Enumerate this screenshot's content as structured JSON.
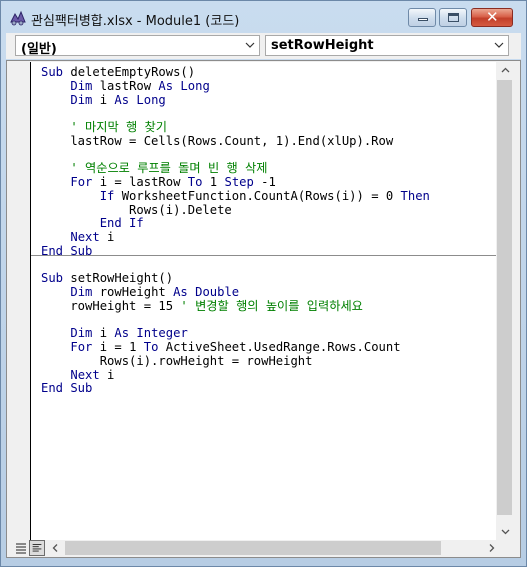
{
  "window": {
    "title": "관심팩터병합.xlsx - Module1 (코드)",
    "minimize_icon": "minimize-icon",
    "maximize_icon": "maximize-icon",
    "close_icon": "close-icon",
    "close_glyph": "✕"
  },
  "toolbar": {
    "object_combo_value": "(일반)",
    "procedure_combo_value": "setRowHeight",
    "dropdown_icon": "chevron-down-icon"
  },
  "code": {
    "lines": [
      [
        {
          "t": "Sub ",
          "c": "kw"
        },
        {
          "t": "deleteEmptyRows()",
          "c": "tx"
        }
      ],
      [
        {
          "t": "    ",
          "c": "tx"
        },
        {
          "t": "Dim ",
          "c": "kw"
        },
        {
          "t": "lastRow ",
          "c": "tx"
        },
        {
          "t": "As Long",
          "c": "kw"
        }
      ],
      [
        {
          "t": "    ",
          "c": "tx"
        },
        {
          "t": "Dim ",
          "c": "kw"
        },
        {
          "t": "i ",
          "c": "tx"
        },
        {
          "t": "As Long",
          "c": "kw"
        }
      ],
      [],
      [
        {
          "t": "    ' 마지막 행 찾기",
          "c": "cm"
        }
      ],
      [
        {
          "t": "    lastRow = Cells(Rows.Count, 1).End(xlUp).Row",
          "c": "tx"
        }
      ],
      [],
      [
        {
          "t": "    ' 역순으로 루프를 돌며 빈 행 삭제",
          "c": "cm"
        }
      ],
      [
        {
          "t": "    ",
          "c": "tx"
        },
        {
          "t": "For ",
          "c": "kw"
        },
        {
          "t": "i = lastRow ",
          "c": "tx"
        },
        {
          "t": "To ",
          "c": "kw"
        },
        {
          "t": "1 ",
          "c": "tx"
        },
        {
          "t": "Step ",
          "c": "kw"
        },
        {
          "t": "-1",
          "c": "tx"
        }
      ],
      [
        {
          "t": "        ",
          "c": "tx"
        },
        {
          "t": "If ",
          "c": "kw"
        },
        {
          "t": "WorksheetFunction.CountA(Rows(i)) = 0 ",
          "c": "tx"
        },
        {
          "t": "Then",
          "c": "kw"
        }
      ],
      [
        {
          "t": "            Rows(i).Delete",
          "c": "tx"
        }
      ],
      [
        {
          "t": "        ",
          "c": "tx"
        },
        {
          "t": "End If",
          "c": "kw"
        }
      ],
      [
        {
          "t": "    ",
          "c": "tx"
        },
        {
          "t": "Next ",
          "c": "kw"
        },
        {
          "t": "i",
          "c": "tx"
        }
      ],
      [
        {
          "t": "End Sub",
          "c": "kw"
        }
      ],
      [],
      [
        {
          "t": "Sub ",
          "c": "kw"
        },
        {
          "t": "setRowHeight()",
          "c": "tx"
        }
      ],
      [
        {
          "t": "    ",
          "c": "tx"
        },
        {
          "t": "Dim ",
          "c": "kw"
        },
        {
          "t": "rowHeight ",
          "c": "tx"
        },
        {
          "t": "As Double",
          "c": "kw"
        }
      ],
      [
        {
          "t": "    rowHeight = 15 ",
          "c": "tx"
        },
        {
          "t": "' 변경할 행의 높이를 입력하세요",
          "c": "cm"
        }
      ],
      [],
      [
        {
          "t": "    ",
          "c": "tx"
        },
        {
          "t": "Dim ",
          "c": "kw"
        },
        {
          "t": "i ",
          "c": "tx"
        },
        {
          "t": "As Integer",
          "c": "kw"
        }
      ],
      [
        {
          "t": "    ",
          "c": "tx"
        },
        {
          "t": "For ",
          "c": "kw"
        },
        {
          "t": "i = 1 ",
          "c": "tx"
        },
        {
          "t": "To ",
          "c": "kw"
        },
        {
          "t": "ActiveSheet.UsedRange.Rows.Count",
          "c": "tx"
        }
      ],
      [
        {
          "t": "        Rows(i).rowHeight = rowHeight",
          "c": "tx"
        }
      ],
      [
        {
          "t": "    ",
          "c": "tx"
        },
        {
          "t": "Next ",
          "c": "kw"
        },
        {
          "t": "i",
          "c": "tx"
        }
      ],
      [
        {
          "t": "End Sub",
          "c": "kw"
        }
      ]
    ],
    "colors": {
      "keyword": "#00008b",
      "text": "#000000",
      "comment": "#008000"
    }
  },
  "icons": {
    "app": "vba-code-window-icon",
    "scroll_up": "arrow-up-icon",
    "scroll_down": "arrow-down-icon",
    "scroll_left": "arrow-left-icon",
    "scroll_right": "arrow-right-icon",
    "procedure_view": "procedure-view-icon",
    "full_module_view": "full-module-view-icon"
  }
}
